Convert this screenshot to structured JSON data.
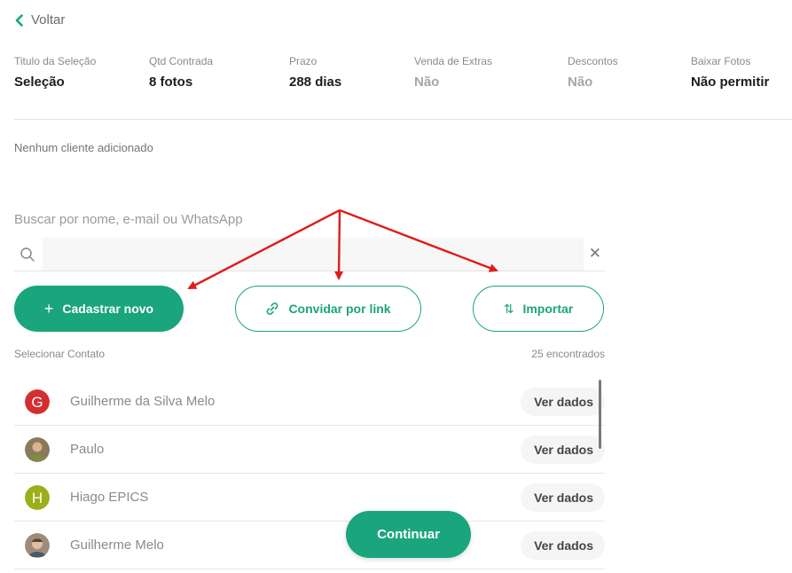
{
  "back": {
    "label": "Voltar"
  },
  "summary": [
    {
      "label": "Titulo da Seleção",
      "value": "Seleção",
      "muted": false
    },
    {
      "label": "Qtd Contrada",
      "value": "8 fotos",
      "muted": false
    },
    {
      "label": "Prazo",
      "value": "288 dias",
      "muted": false
    },
    {
      "label": "Venda de Extras",
      "value": "Não",
      "muted": true
    },
    {
      "label": "Descontos",
      "value": "Não",
      "muted": true
    },
    {
      "label": "Baixar Fotos",
      "value": "Não permitir",
      "muted": false
    }
  ],
  "clients": {
    "empty_text": "Nenhum cliente adicionado"
  },
  "search": {
    "label": "Buscar por nome, e-mail ou WhatsApp",
    "value": "",
    "placeholder": "",
    "clear_glyph": "✕"
  },
  "actions": {
    "register": {
      "label": "Cadastrar novo",
      "icon_glyph": "+"
    },
    "invite": {
      "label": "Convidar por link"
    },
    "import": {
      "label": "Importar",
      "icon_glyph": "⇅"
    }
  },
  "list": {
    "title": "Selecionar Contato",
    "count": "25 encontrados",
    "view_label": "Ver dados",
    "contacts": [
      {
        "name": "Guilherme da Silva Melo",
        "avatar": "letter",
        "initial": "G",
        "color": "#d32f2f"
      },
      {
        "name": "Paulo",
        "avatar": "photo",
        "initial": "",
        "color": "#8a7a5c"
      },
      {
        "name": "Hiago EPICS",
        "avatar": "letter",
        "initial": "H",
        "color": "#9cae1a"
      },
      {
        "name": "Guilherme Melo",
        "avatar": "photo",
        "initial": "",
        "color": "#a08a78"
      }
    ]
  },
  "continue": {
    "label": "Continuar"
  },
  "colors": {
    "accent": "#1aa57c",
    "annotation": "#e01b1b"
  }
}
